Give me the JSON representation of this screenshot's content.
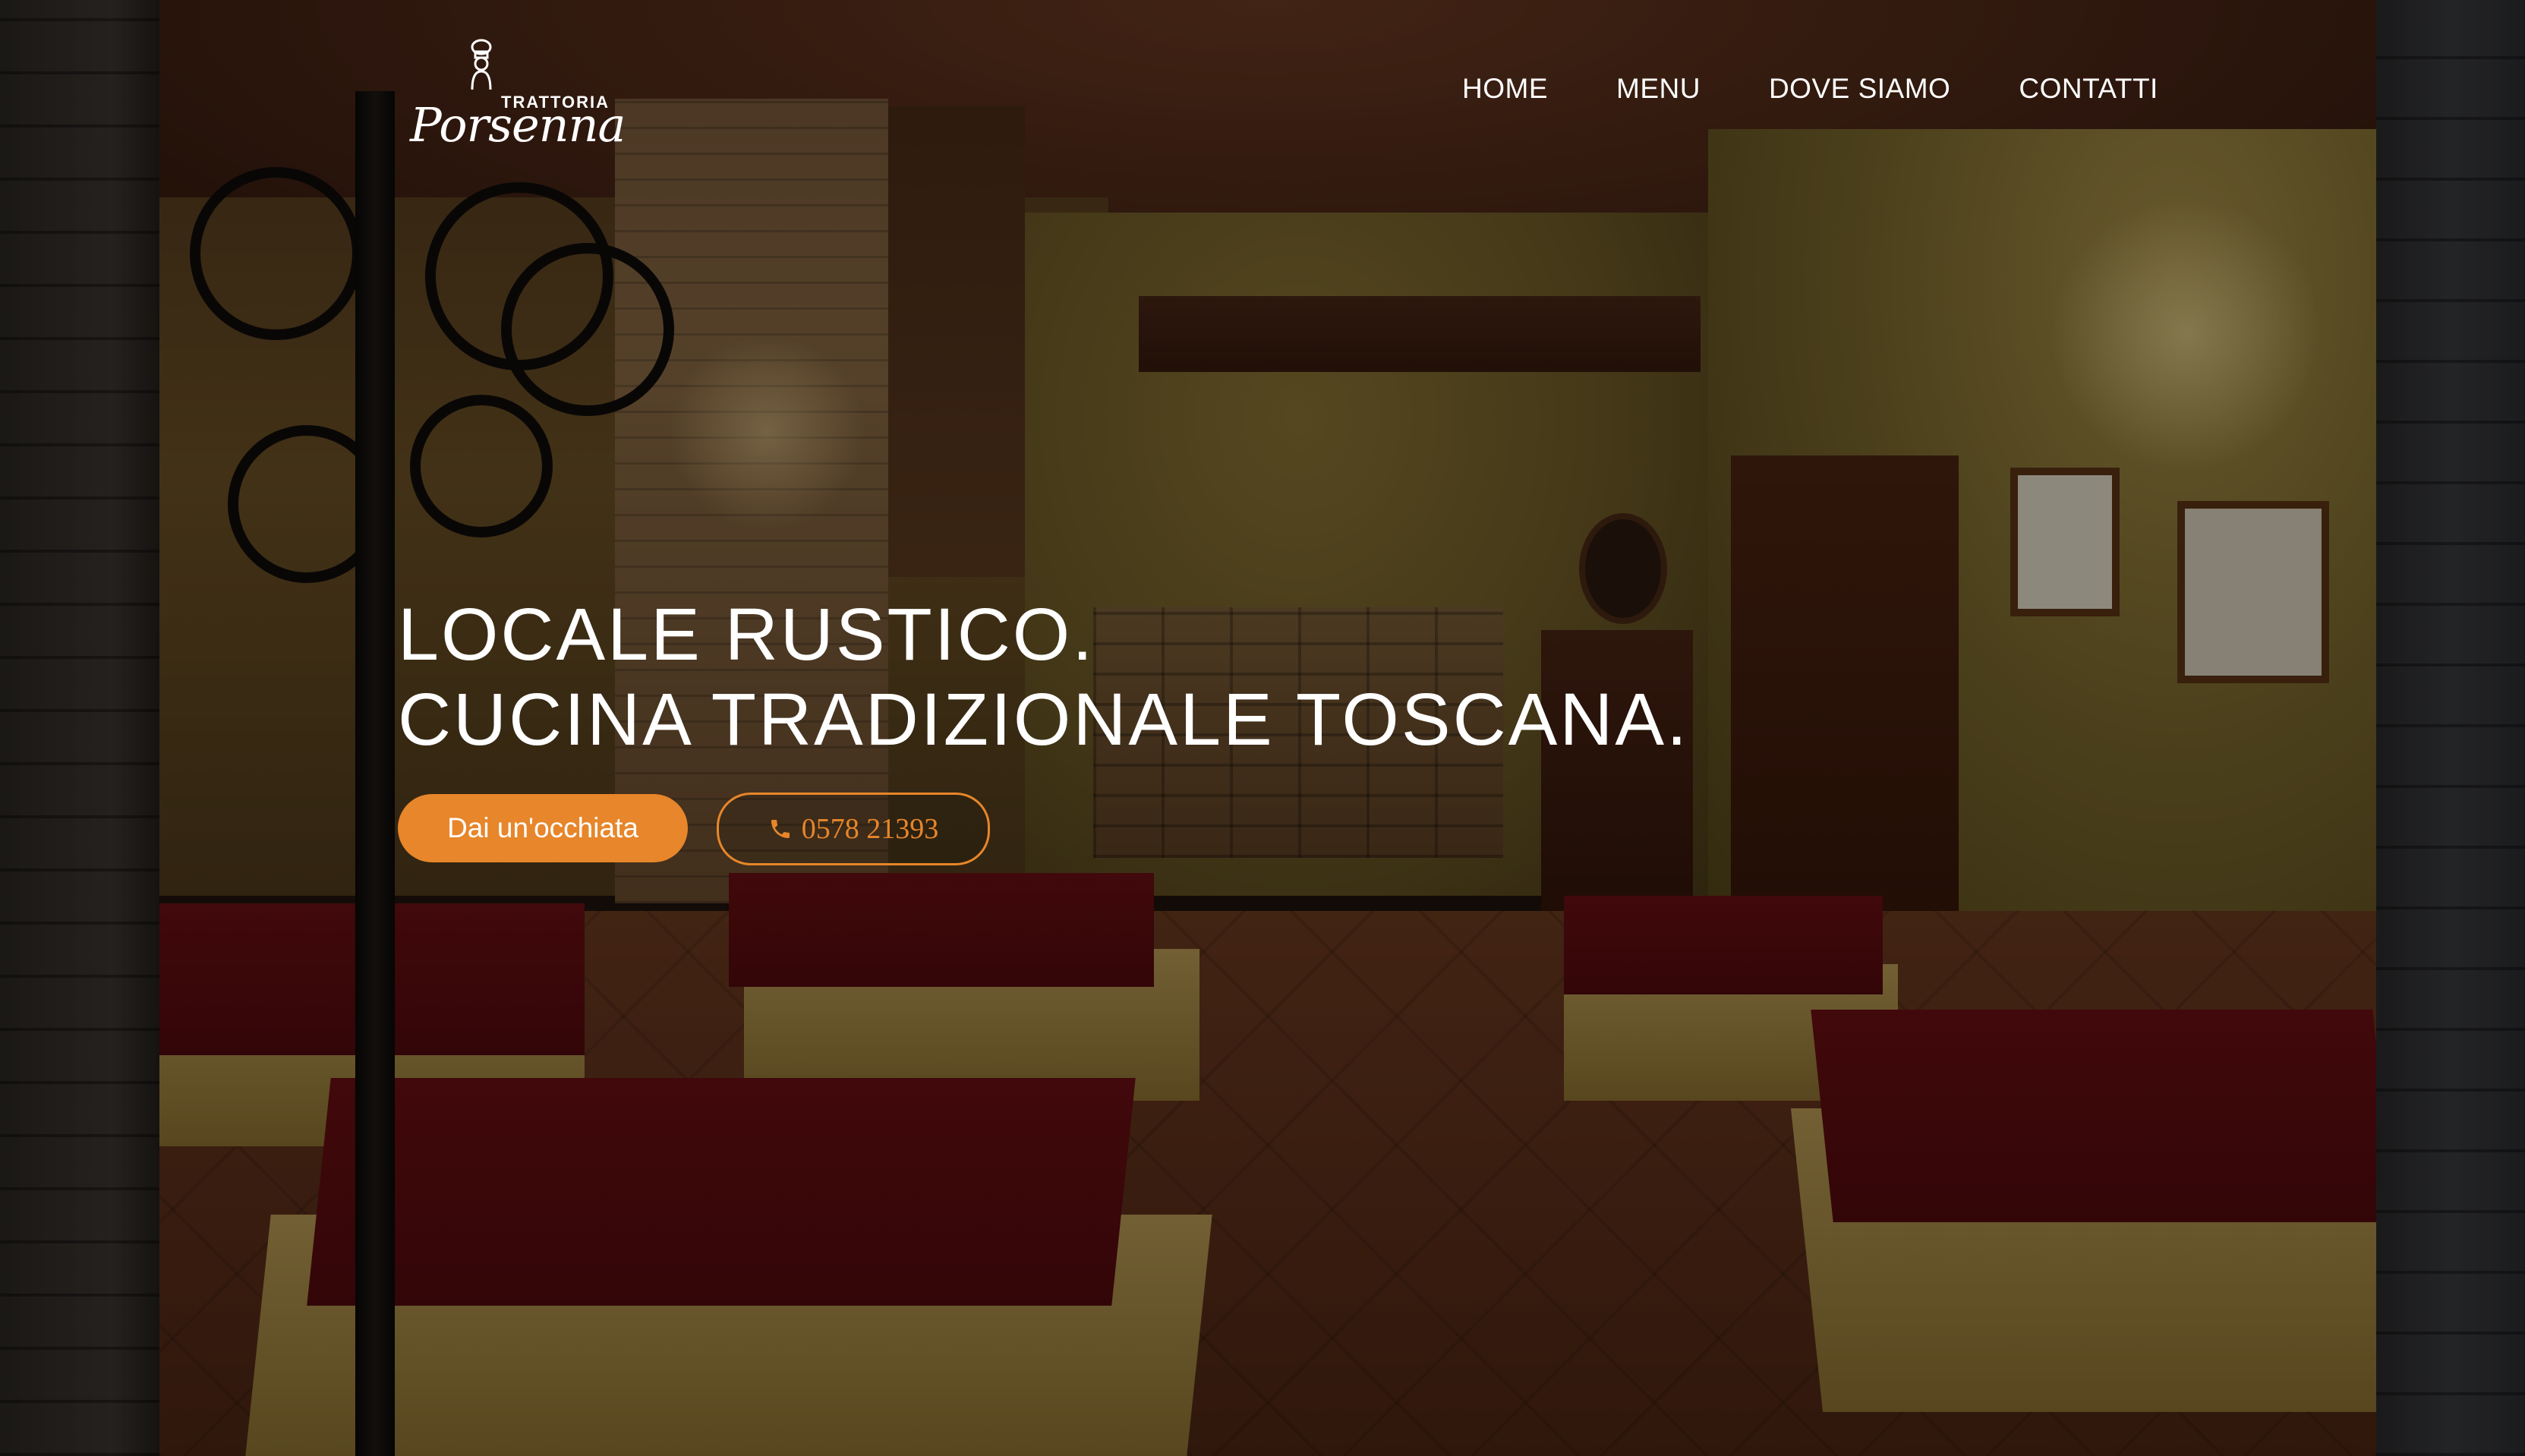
{
  "logo": {
    "small_text": "TRATTORIA",
    "script_text": "Porsenna"
  },
  "nav": {
    "items": [
      {
        "label": "HOME"
      },
      {
        "label": "MENU"
      },
      {
        "label": "DOVE SIAMO"
      },
      {
        "label": "CONTATTI"
      }
    ]
  },
  "hero": {
    "line1": "LOCALE RUSTICO.",
    "line2": "CUCINA TRADIZIONALE TOSCANA.",
    "primary_button": "Dai un'occhiata",
    "phone_button": "0578 21393",
    "phone_icon": "phone-icon"
  },
  "colors": {
    "accent": "#e7862a",
    "text": "#ffffff"
  }
}
